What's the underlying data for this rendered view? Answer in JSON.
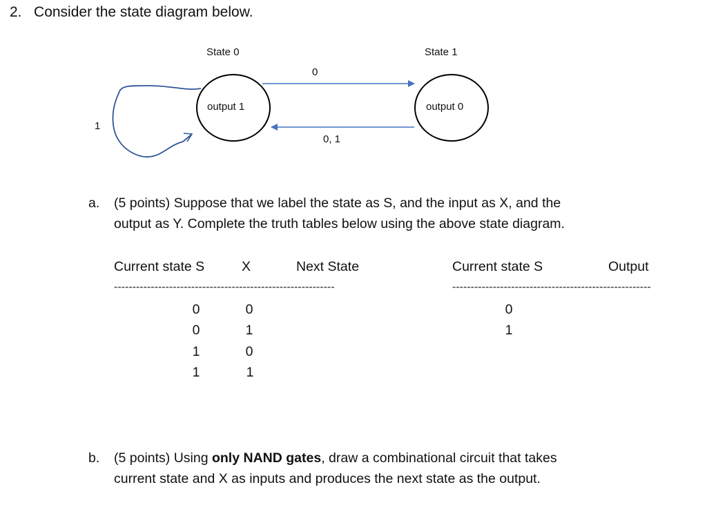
{
  "question": {
    "number": "2.",
    "prompt": "Consider the state diagram below."
  },
  "diagram": {
    "states": [
      {
        "name": "State 0",
        "output_label": "output 1"
      },
      {
        "name": "State 1",
        "output_label": "output 0"
      }
    ],
    "transitions": [
      {
        "from": "State 0",
        "to": "State 1",
        "label": "0"
      },
      {
        "from": "State 1",
        "to": "State 0",
        "label": "0, 1"
      },
      {
        "from": "State 0",
        "to": "State 0",
        "label": "1"
      }
    ],
    "colors": {
      "arrow": "#4472c4",
      "self_loop": "#2f5597",
      "circle": "#000000"
    }
  },
  "part_a": {
    "letter": "a.",
    "line1": "(5 points) Suppose that we label the state as S, and the input as X, and the",
    "line2": "output as Y. Complete the truth tables below using the above state diagram."
  },
  "table1": {
    "headers": [
      "Current state S",
      "X",
      "Next State"
    ],
    "separator": "------------------------------------------------------------",
    "rows": [
      {
        "s": "0",
        "x": "0",
        "next": ""
      },
      {
        "s": "0",
        "x": "1",
        "next": ""
      },
      {
        "s": "1",
        "x": "0",
        "next": ""
      },
      {
        "s": "1",
        "x": "1",
        "next": ""
      }
    ]
  },
  "table2": {
    "headers": [
      "Current state S",
      "Output"
    ],
    "separator": "------------------------------------------------------",
    "rows": [
      {
        "s": "0",
        "out": ""
      },
      {
        "s": "1",
        "out": ""
      }
    ]
  },
  "part_b": {
    "letter": "b.",
    "line1_pre": "(5 points) Using ",
    "line1_bold": "only NAND gates",
    "line1_post": ", draw a combinational circuit that takes",
    "line2": "current state and X as inputs and produces the next state as the output."
  }
}
